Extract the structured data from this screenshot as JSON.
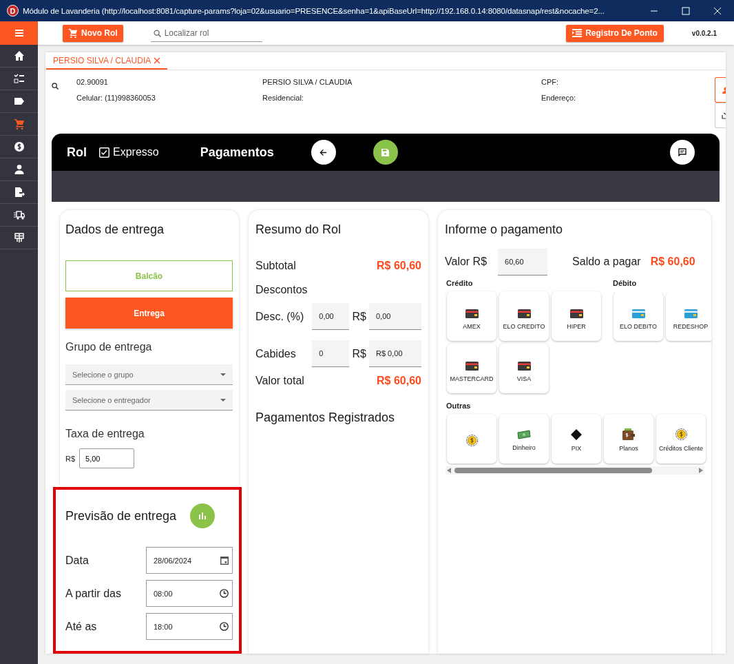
{
  "window": {
    "logo_letter": "D",
    "title": "Módulo de Lavanderia (http://localhost:8081/capture-params?loja=02&usuario=PRESENCE&senha=1&apiBaseUrl=http://192.168.0.14:8080/datasnap/rest&nocache=2..."
  },
  "sidebar": {
    "items": [
      {
        "kind": "home",
        "selected": false
      },
      {
        "kind": "checklist",
        "selected": false
      },
      {
        "kind": "tag",
        "selected": false
      },
      {
        "kind": "cart",
        "selected": true
      },
      {
        "kind": "money",
        "selected": false
      },
      {
        "kind": "person",
        "selected": false
      },
      {
        "kind": "export",
        "selected": false
      },
      {
        "kind": "truck",
        "selected": false
      },
      {
        "kind": "gift",
        "selected": false
      }
    ]
  },
  "topbar": {
    "new_button": "Novo Rol",
    "search": {
      "placeholder": "Localizar rol"
    },
    "clock_button": "Registro De Ponto",
    "version": "v0.0.2.1"
  },
  "tabs": [
    {
      "label": "PERSIO SILVA / CLAUDIA",
      "selected": true
    }
  ],
  "customer": {
    "code": "02.90091",
    "phone": "Celular: (11)998360053",
    "name": "PERSIO SILVA / CLAUDIA",
    "home_phone": "Residencial:",
    "cpf": "CPF:",
    "address": "Endereço:"
  },
  "header": {
    "title": "Rol",
    "express": {
      "label": "Expresso",
      "checked": true
    },
    "section": "Pagamentos"
  },
  "delivery": {
    "title": "Dados de entrega",
    "modes": [
      {
        "label": "Balcão",
        "selected": false
      },
      {
        "label": "Entrega",
        "selected": true
      }
    ],
    "group_title": "Grupo de entrega",
    "selects": [
      {
        "placeholder": "Selecione o grupo"
      },
      {
        "placeholder": "Selecione o entregador"
      }
    ],
    "fee_title": "Taxa de entrega",
    "fee_currency": "R$",
    "fee_value": "5,00"
  },
  "forecast": {
    "title": "Previsão de entrega",
    "fields": [
      {
        "label": "Data",
        "value": "28/06/2024",
        "kind": "date"
      },
      {
        "label": "A partir das",
        "value": "08:00",
        "kind": "time"
      },
      {
        "label": "Até as",
        "value": "18:00",
        "kind": "time"
      }
    ]
  },
  "summary": {
    "title": "Resumo do Rol",
    "subtotal_label": "Subtotal",
    "subtotal": "R$ 60,60",
    "discounts_label": "Descontos",
    "rows": [
      {
        "label": "Desc. (%)",
        "qty": "0,00",
        "currency": "R$",
        "amount": "0,00"
      },
      {
        "label": "Cabides",
        "qty": "0",
        "currency": "R$",
        "amount": "R$ 0,00"
      }
    ],
    "total_label": "Valor total",
    "total": "R$ 60,60",
    "registered_title": "Pagamentos Registrados"
  },
  "payment": {
    "title": "Informe o pagamento",
    "amount_label": "Valor R$",
    "amount": "60,60",
    "balance_label": "Saldo a pagar",
    "balance": "R$ 60,60",
    "groups": [
      {
        "title": "Crédito",
        "methods": [
          {
            "label": "AMEX",
            "kind": "credit"
          },
          {
            "label": "ELO CREDITO",
            "kind": "credit"
          },
          {
            "label": "HIPER",
            "kind": "credit"
          },
          {
            "label": "MASTERCARD",
            "kind": "credit"
          },
          {
            "label": "VISA",
            "kind": "credit"
          }
        ]
      },
      {
        "title": "Débito",
        "methods": [
          {
            "label": "ELO DEBITO",
            "kind": "debit"
          },
          {
            "label": "REDESHOP",
            "kind": "debit"
          }
        ]
      },
      {
        "title": "Outras",
        "methods": [
          {
            "kind": "coin"
          },
          {
            "label": "Dinheiro",
            "kind": "cash"
          },
          {
            "label": "PIX",
            "kind": "pix"
          },
          {
            "label": "Planos",
            "kind": "wallet"
          },
          {
            "label": "Créditos Cliente",
            "kind": "coin"
          }
        ]
      }
    ]
  }
}
